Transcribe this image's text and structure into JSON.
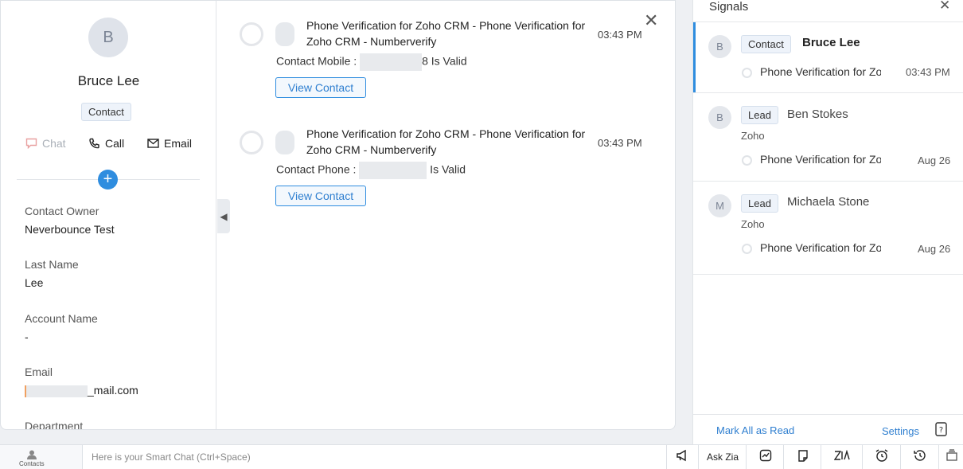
{
  "contact": {
    "initial": "B",
    "name": "Bruce Lee",
    "tag": "Contact",
    "actions": {
      "chat": "Chat",
      "call": "Call",
      "email": "Email"
    },
    "fields": [
      {
        "label": "Contact Owner",
        "value": "Neverbounce Test"
      },
      {
        "label": "Last Name",
        "value": "Lee"
      },
      {
        "label": "Account Name",
        "value": "-"
      },
      {
        "label": "Email",
        "value": "_mail.com"
      },
      {
        "label": "Department",
        "value": ""
      }
    ]
  },
  "notifications": [
    {
      "title": "Phone Verification for Zoho CRM - Phone Verification for Zoho CRM - Numberverify",
      "time": "03:43 PM",
      "body_prefix": "Contact Mobile : ",
      "body_partial": "8",
      "body_suffix": " Is Valid",
      "button": "View Contact"
    },
    {
      "title": "Phone Verification for Zoho CRM - Phone Verification for Zoho CRM - Numberverify",
      "time": "03:43 PM",
      "body_prefix": "Contact Phone : ",
      "body_partial": "",
      "body_suffix": " Is Valid",
      "button": "View Contact"
    }
  ],
  "signals": {
    "title": "Signals",
    "items": [
      {
        "initial": "B",
        "tag": "Contact",
        "name": "Bruce Lee",
        "org": "",
        "text": "Phone Verification for Zoho CRM",
        "time": "03:43 PM",
        "unread": true
      },
      {
        "initial": "B",
        "tag": "Lead",
        "name": "Ben Stokes",
        "org": "Zoho",
        "text": "Phone Verification for Zoho CRM",
        "time": "Aug 26",
        "unread": false
      },
      {
        "initial": "M",
        "tag": "Lead",
        "name": "Michaela Stone",
        "org": "Zoho",
        "text": "Phone Verification for Zoho CRM",
        "time": "Aug 26",
        "unread": false
      }
    ],
    "footer": {
      "mark_all": "Mark All as Read",
      "settings": "Settings"
    }
  },
  "bottom_bar": {
    "contacts_label": "Contacts",
    "smart_chat_placeholder": "Here is your Smart Chat (Ctrl+Space)",
    "ask_zia": "Ask Zia",
    "tools": [
      "megaphone-icon",
      "ask-zia",
      "chart-icon",
      "note-icon",
      "zia-icon",
      "alarm-icon",
      "history-icon",
      "cards-icon"
    ]
  },
  "colors": {
    "accent": "#2f8ddf",
    "tag_bg": "#eef3fa",
    "avatar_bg": "#dfe3ea"
  }
}
